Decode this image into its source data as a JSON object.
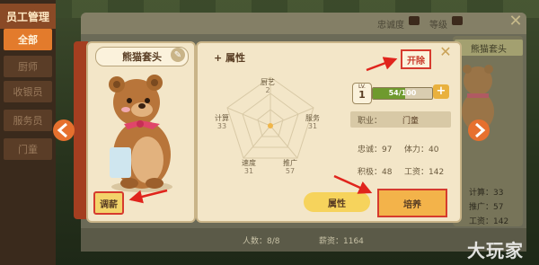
{
  "sidebar": {
    "title": "员工管理",
    "items": [
      {
        "label": "全部",
        "active": true
      },
      {
        "label": "厨师",
        "active": false
      },
      {
        "label": "收银员",
        "active": false
      },
      {
        "label": "服务员",
        "active": false
      },
      {
        "label": "门童",
        "active": false
      }
    ]
  },
  "background": {
    "sort_loyalty": "忠诚度",
    "sort_level": "等级",
    "right_card_title": "熊猫套头",
    "right_card_stats": [
      "计算：33",
      "推广：57",
      "工资：142"
    ],
    "headcount": "人数：8/8",
    "total_wage": "薪资：1164"
  },
  "employee": {
    "name": "熊猫套头",
    "promote_label": "调薪",
    "fire_label": "开除",
    "attr_heading": "属性",
    "level_prefix": "LV.",
    "level": "1",
    "xp_text": "54/100",
    "xp_fraction": 0.54,
    "job_label": "职业：",
    "job_value": "门童",
    "loyalty": "忠诚：97",
    "stamina": "体力：40",
    "rank": "积极：48",
    "wage": "工资：142",
    "radar": [
      {
        "label": "厨艺",
        "value": "2"
      },
      {
        "label": "服务",
        "value": "31"
      },
      {
        "label": "推广",
        "value": "57"
      },
      {
        "label": "速度",
        "value": "31"
      },
      {
        "label": "计算",
        "value": "33"
      }
    ]
  },
  "buttons": {
    "attributes": "属性",
    "train": "培养"
  },
  "watermark": "大玩家",
  "colors": {
    "accent_orange": "#e37b2c",
    "highlight_red": "#d63b2e",
    "panel_cream": "#f3e6c8",
    "xp_green": "#6f9a2e"
  }
}
